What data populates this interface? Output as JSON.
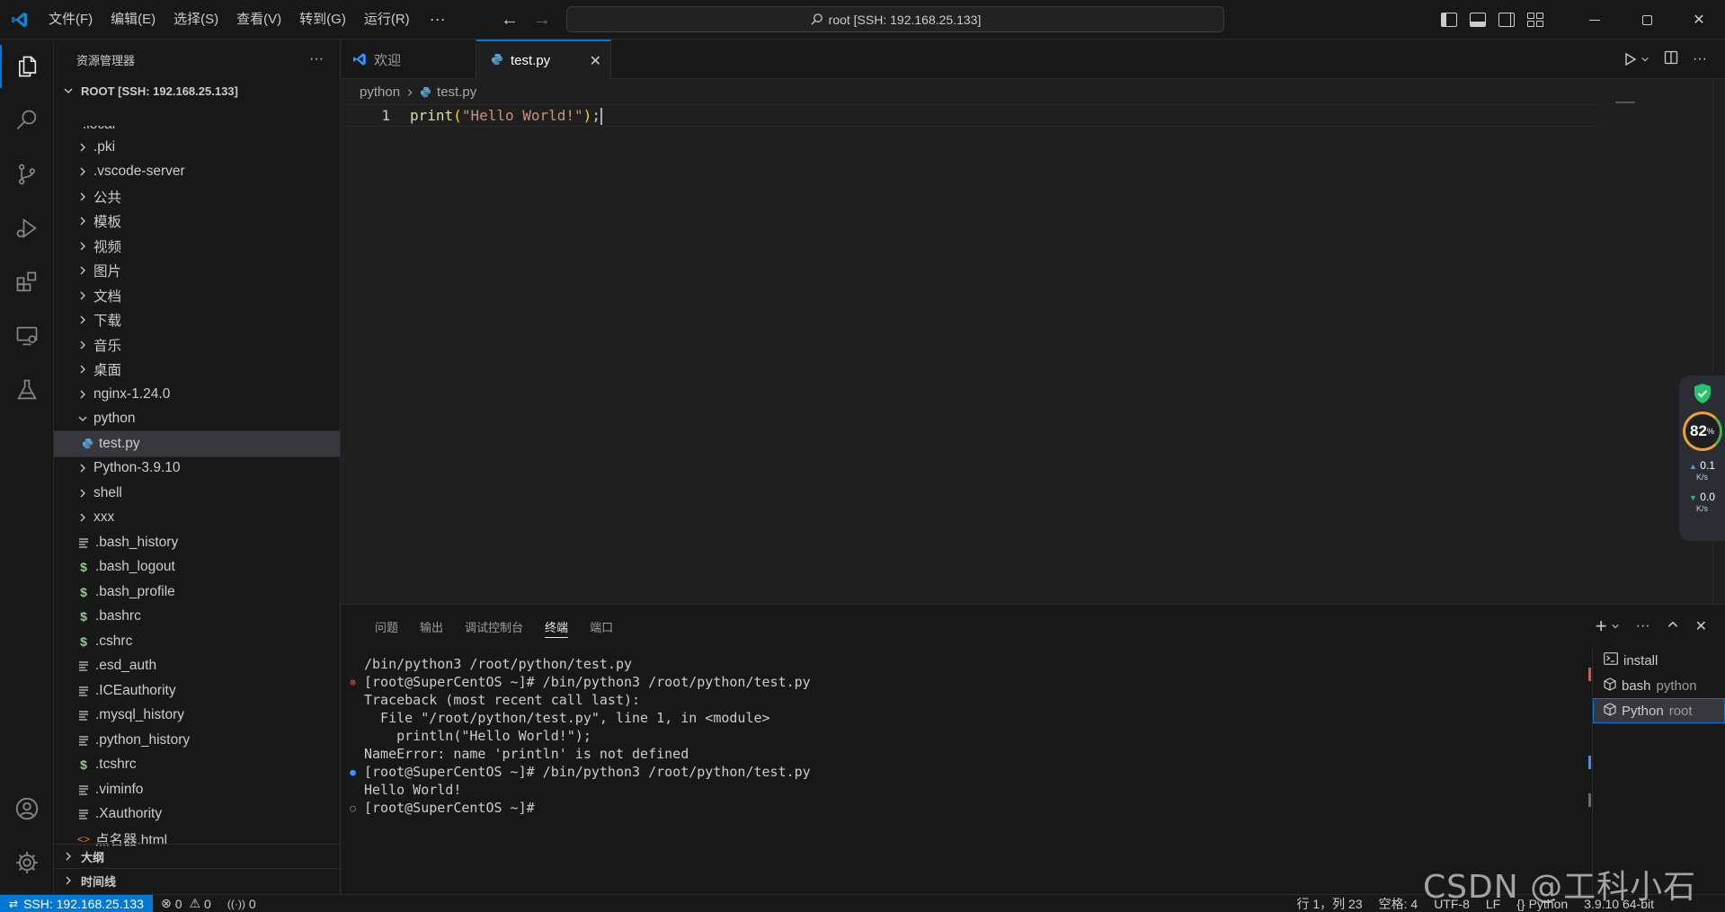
{
  "titlebar": {
    "menus": [
      "文件(F)",
      "编辑(E)",
      "选择(S)",
      "查看(V)",
      "转到(G)",
      "运行(R)"
    ],
    "more": "···",
    "command_center": "root [SSH: 192.168.25.133]"
  },
  "sidebar": {
    "header": "资源管理器",
    "more": "···",
    "root": "ROOT [SSH: 192.168.25.133]",
    "partial_top": ".local",
    "items": [
      {
        "label": ".pki",
        "type": "folder"
      },
      {
        "label": ".vscode-server",
        "type": "folder"
      },
      {
        "label": "公共",
        "type": "folder"
      },
      {
        "label": "模板",
        "type": "folder"
      },
      {
        "label": "视频",
        "type": "folder"
      },
      {
        "label": "图片",
        "type": "folder"
      },
      {
        "label": "文档",
        "type": "folder"
      },
      {
        "label": "下载",
        "type": "folder"
      },
      {
        "label": "音乐",
        "type": "folder"
      },
      {
        "label": "桌面",
        "type": "folder"
      },
      {
        "label": "nginx-1.24.0",
        "type": "folder"
      },
      {
        "label": "python",
        "type": "folder-open"
      },
      {
        "label": "test.py",
        "type": "py"
      },
      {
        "label": "Python-3.9.10",
        "type": "folder"
      },
      {
        "label": "shell",
        "type": "folder"
      },
      {
        "label": "xxx",
        "type": "folder"
      },
      {
        "label": ".bash_history",
        "type": "text"
      },
      {
        "label": ".bash_logout",
        "type": "shell"
      },
      {
        "label": ".bash_profile",
        "type": "shell"
      },
      {
        "label": ".bashrc",
        "type": "shell"
      },
      {
        "label": ".cshrc",
        "type": "shell"
      },
      {
        "label": ".esd_auth",
        "type": "text"
      },
      {
        "label": ".ICEauthority",
        "type": "text"
      },
      {
        "label": ".mysql_history",
        "type": "text"
      },
      {
        "label": ".python_history",
        "type": "text"
      },
      {
        "label": ".tcshrc",
        "type": "shell"
      },
      {
        "label": ".viminfo",
        "type": "text"
      },
      {
        "label": ".Xauthority",
        "type": "text"
      },
      {
        "label": "点名器.html",
        "type": "html"
      }
    ],
    "outline": "大纲",
    "timeline": "时间线"
  },
  "tabs": {
    "welcome": "欢迎",
    "active": "test.py",
    "close": "✕"
  },
  "editor": {
    "breadcrumb_folder": "python",
    "breadcrumb_file": "test.py",
    "line_number": "1",
    "code_fn": "print",
    "code_open": "(",
    "code_str": "\"Hello World!\"",
    "code_close": ")",
    "code_semi": ";"
  },
  "widget": {
    "percent": "82",
    "percent_sign": "%",
    "up": "0.1",
    "down": "0.0",
    "unit": "K/s"
  },
  "panel": {
    "tabs": [
      "问题",
      "输出",
      "调试控制台",
      "终端",
      "端口"
    ],
    "active_tab": "终端",
    "terminal_lines": [
      {
        "mark": "",
        "text": "/bin/python3 /root/python/test.py"
      },
      {
        "mark": "err",
        "text": "[root@SuperCentOS ~]# /bin/python3 /root/python/test.py"
      },
      {
        "mark": "",
        "text": "Traceback (most recent call last):"
      },
      {
        "mark": "",
        "text": "  File \"/root/python/test.py\", line 1, in <module>"
      },
      {
        "mark": "",
        "text": "    println(\"Hello World!\");"
      },
      {
        "mark": "",
        "text": "NameError: name 'println' is not defined"
      },
      {
        "mark": "ok",
        "text": "[root@SuperCentOS ~]# /bin/python3 /root/python/test.py"
      },
      {
        "mark": "",
        "text": "Hello World!"
      },
      {
        "mark": "empty",
        "text": "[root@SuperCentOS ~]#"
      }
    ],
    "terminals": [
      {
        "name": "install",
        "detail": ""
      },
      {
        "name": "bash",
        "detail": "python"
      },
      {
        "name": "Python",
        "detail": "root"
      }
    ]
  },
  "statusbar": {
    "remote": "SSH: 192.168.25.133",
    "errors": "0",
    "warnings": "0",
    "ports": "0",
    "position": "行 1，列 23",
    "spaces": "空格: 4",
    "encoding": "UTF-8",
    "eol": "LF",
    "language": "Python",
    "interpreter": "3.9.10 64-bit"
  },
  "watermark": "CSDN @工科小石头"
}
